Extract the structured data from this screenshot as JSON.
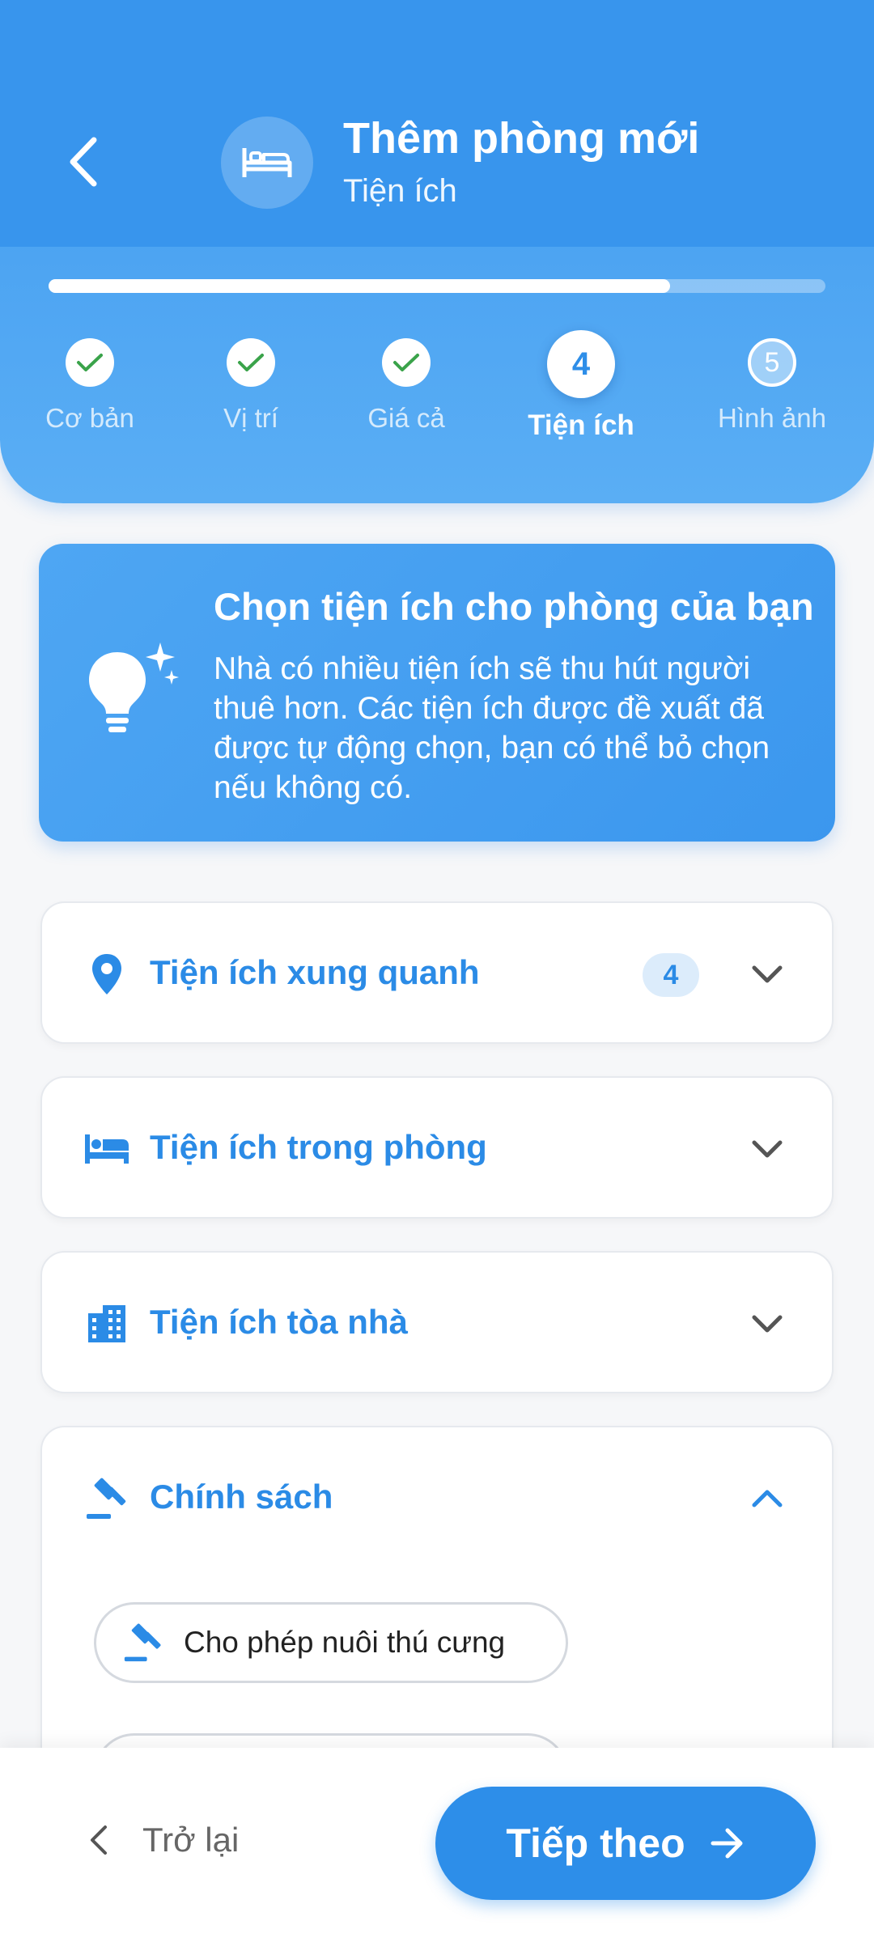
{
  "header": {
    "title": "Thêm phòng mới",
    "subtitle": "Tiện ích",
    "progress": 0.8,
    "steps": [
      {
        "label": "Cơ bản",
        "state": "done"
      },
      {
        "label": "Vị trí",
        "state": "done"
      },
      {
        "label": "Giá cả",
        "state": "done"
      },
      {
        "label": "Tiện ích",
        "number": "4",
        "state": "active"
      },
      {
        "label": "Hình ảnh",
        "number": "5",
        "state": "pending"
      }
    ]
  },
  "info": {
    "title": "Chọn tiện ích cho phòng của bạn",
    "text": "Nhà có nhiều tiện ích sẽ thu hút người thuê hơn. Các tiện ích được đề xuất đã được tự động chọn, bạn có thể bỏ chọn nếu không có."
  },
  "sections": [
    {
      "title": "Tiện ích xung quanh",
      "badge": "4",
      "icon": "location-pin-icon",
      "expanded": false
    },
    {
      "title": "Tiện ích trong phòng",
      "icon": "bed-icon",
      "expanded": false
    },
    {
      "title": "Tiện ích tòa nhà",
      "icon": "building-icon",
      "expanded": false
    },
    {
      "title": "Chính sách",
      "icon": "gavel-icon",
      "expanded": true,
      "options": [
        {
          "label": "Cho phép nuôi thú cưng",
          "icon": "gavel-icon"
        }
      ]
    }
  ],
  "footer": {
    "back_label": "Trở lại",
    "next_label": "Tiếp theo"
  },
  "colors": {
    "primary": "#2d8ee9",
    "header": "#3895ed",
    "check": "#3aa34a"
  }
}
